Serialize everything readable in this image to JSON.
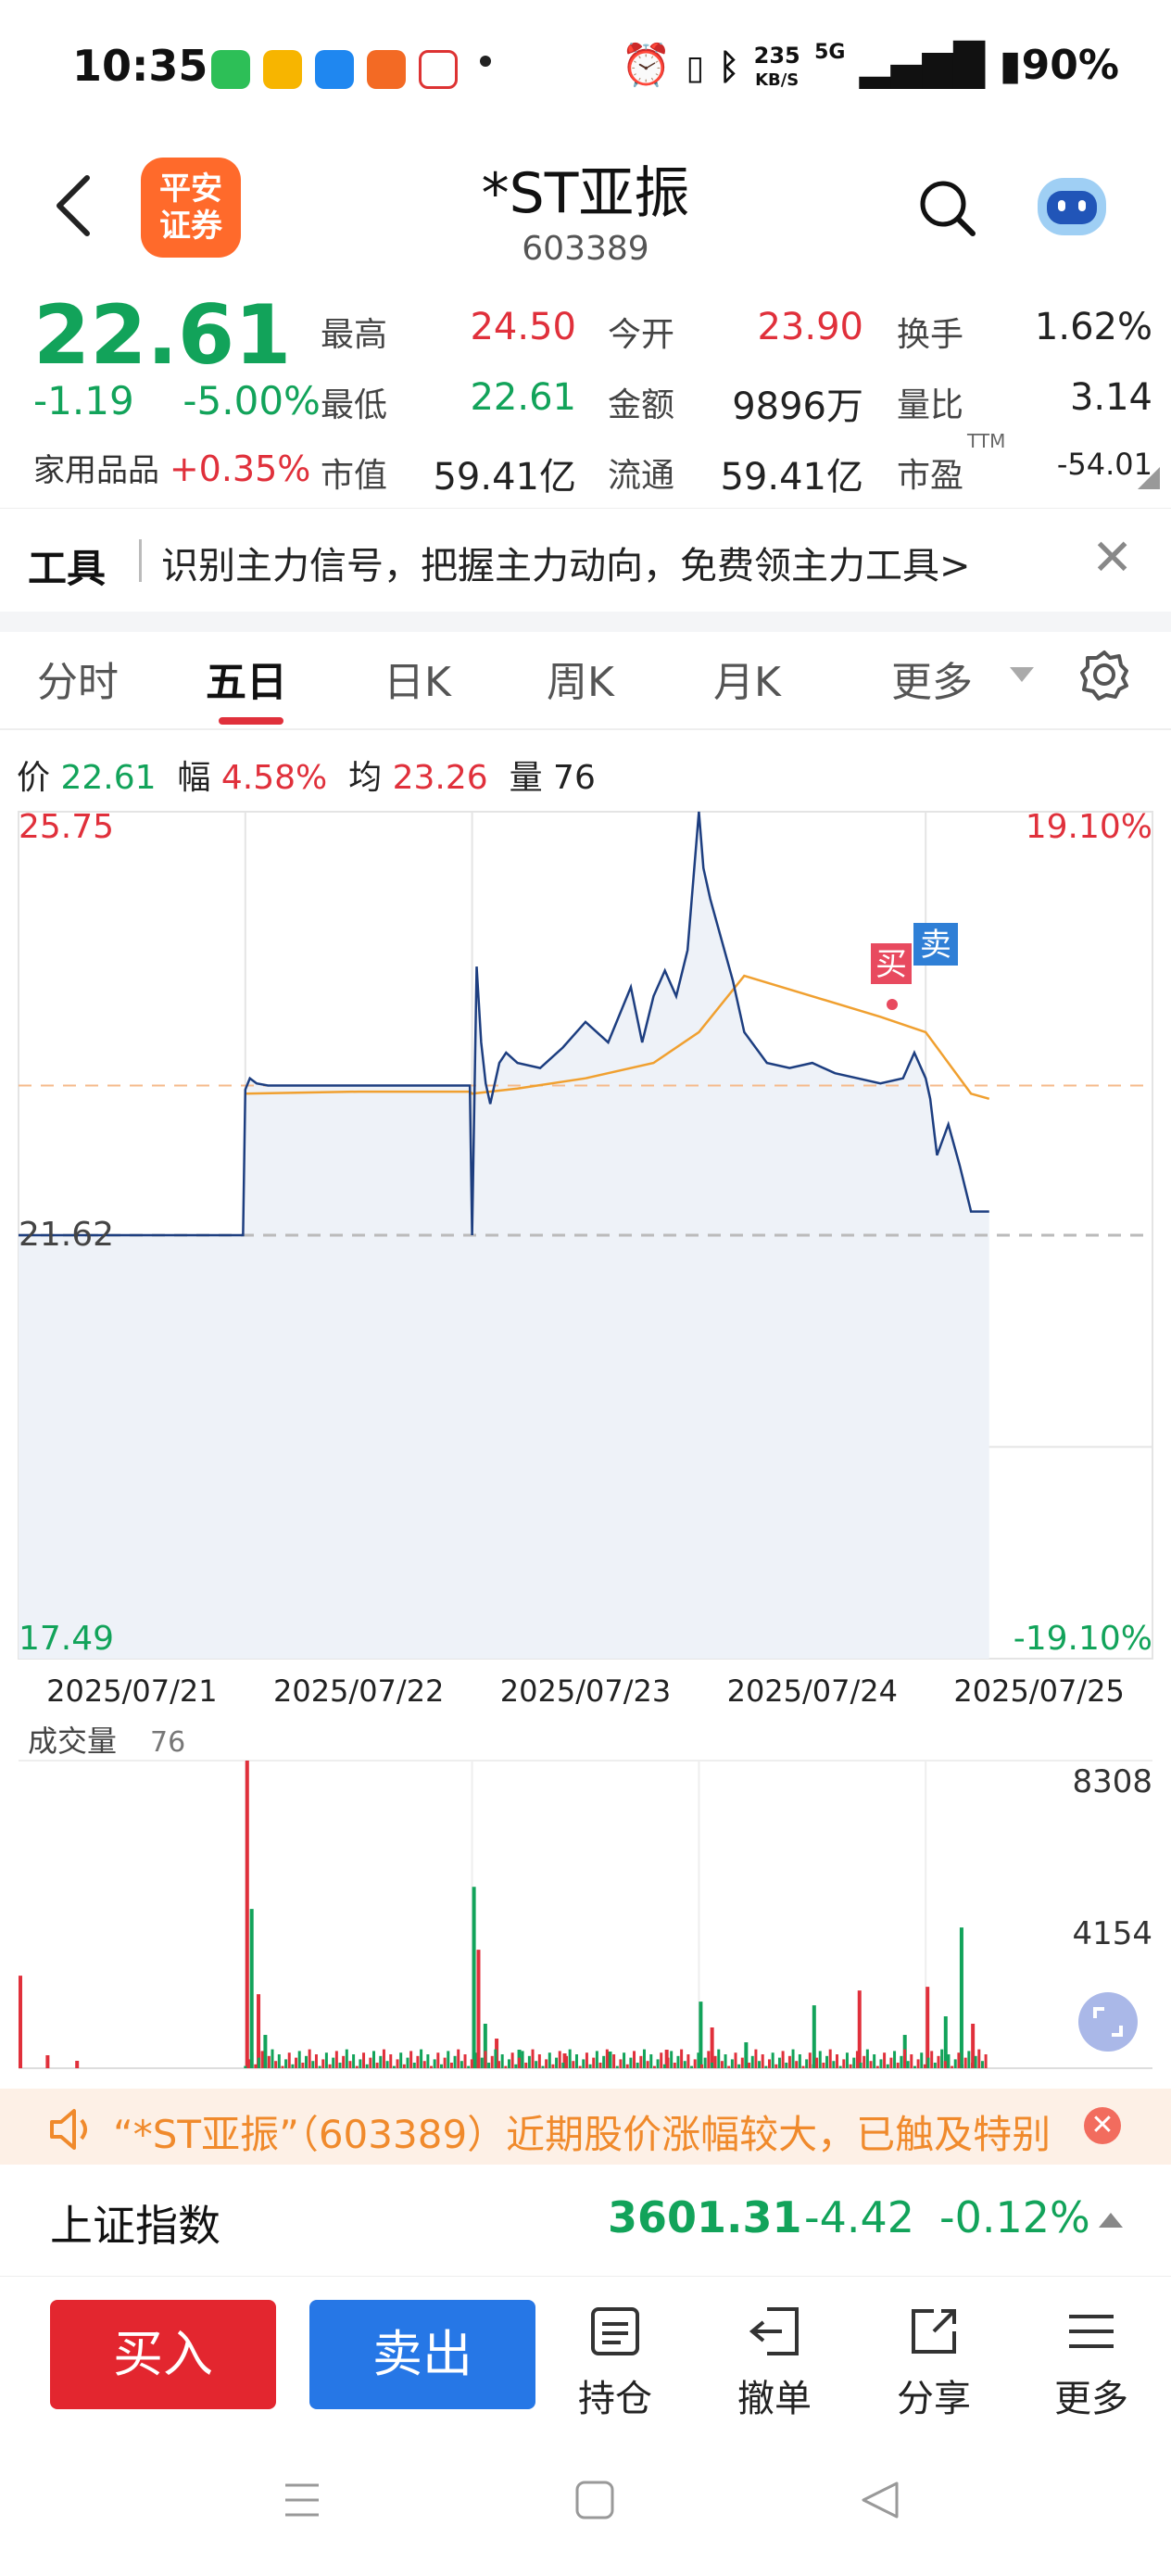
{
  "status": {
    "time": "10:35",
    "net_speed": "235",
    "net_unit": "KB/S",
    "signal": "5G",
    "battery": "90%"
  },
  "header": {
    "name": "*ST亚振",
    "code": "603389",
    "logo": "平安\n证券"
  },
  "quote": {
    "price": "22.61",
    "change": "-1.19",
    "change_pct": "-5.00%",
    "sector": "家用品品",
    "sector_pct": "+0.35%",
    "fields": [
      {
        "label": "最高",
        "value": "24.50",
        "color": "#e0303b"
      },
      {
        "label": "今开",
        "value": "23.90",
        "color": "#e0303b"
      },
      {
        "label": "换手",
        "value": "1.62%",
        "color": "#222"
      },
      {
        "label": "最低",
        "value": "22.61",
        "color": "#12a35a"
      },
      {
        "label": "金额",
        "value": "9896万",
        "color": "#222"
      },
      {
        "label": "量比",
        "value": "3.14",
        "color": "#222"
      },
      {
        "label": "市值",
        "value": "59.41亿",
        "color": "#222"
      },
      {
        "label": "流通",
        "value": "59.41亿",
        "color": "#222"
      },
      {
        "label": "市盈",
        "value": "-54.01",
        "color": "#222"
      }
    ],
    "pe_sup": "TTM"
  },
  "promo": {
    "tag": "工具",
    "text": "识别主力信号，把握主力动向，免费领主力工具>"
  },
  "tabs": [
    "分时",
    "五日",
    "日K",
    "周K",
    "月K",
    "更多"
  ],
  "active_tab": 1,
  "info": {
    "price_label": "价",
    "price": "22.61",
    "amp_label": "幅",
    "amp": "4.58%",
    "avg_label": "均",
    "avg": "23.26",
    "vol_label": "量",
    "vol": "76"
  },
  "chart_labels": {
    "top_price": "25.75",
    "top_pct": "19.10%",
    "mid_price": "21.62",
    "bottom_price": "17.49",
    "bottom_pct": "-19.10%",
    "buy": "买",
    "sell": "卖",
    "vol_title": "成交量",
    "vol_value": "76",
    "vol_max": "8308",
    "vol_mid": "4154"
  },
  "chart_data": {
    "type": "line",
    "title": "",
    "dates": [
      "2025/07/21",
      "2025/07/22",
      "2025/07/23",
      "2025/07/24",
      "2025/07/25"
    ],
    "ylim": [
      17.49,
      25.75
    ],
    "pct_range": [
      "-19.10%",
      "19.10%"
    ],
    "prev_close": 21.62,
    "series": [
      {
        "name": "",
        "x": [
          0,
          0.5,
          0.99,
          1.0,
          1.02,
          1.05,
          1.1,
          1.5,
          1.99,
          2.0,
          2.02,
          2.04,
          2.06,
          2.08,
          2.1,
          2.12,
          2.15,
          2.2,
          2.3,
          2.4,
          2.5,
          2.6,
          2.7,
          2.75,
          2.8,
          2.85,
          2.9,
          2.95,
          3.0,
          3.02,
          3.05,
          3.1,
          3.15,
          3.2,
          3.3,
          3.4,
          3.5,
          3.6,
          3.7,
          3.8,
          3.9,
          3.95,
          4.0,
          4.02,
          4.05,
          4.1,
          4.15,
          4.2,
          4.28
        ],
        "y": [
          21.62,
          21.62,
          21.62,
          23.04,
          23.15,
          23.1,
          23.08,
          23.08,
          23.08,
          21.62,
          24.24,
          23.5,
          23.1,
          22.9,
          23.1,
          23.3,
          23.4,
          23.3,
          23.25,
          23.45,
          23.7,
          23.5,
          24.04,
          23.5,
          23.95,
          24.2,
          23.95,
          24.4,
          25.75,
          25.2,
          24.9,
          24.5,
          24.1,
          23.6,
          23.3,
          23.25,
          23.3,
          23.2,
          23.15,
          23.1,
          23.15,
          23.4,
          23.15,
          22.95,
          22.4,
          22.7,
          22.3,
          21.85,
          21.85
        ]
      },
      {
        "name": "",
        "x": [
          1.0,
          1.5,
          1.99,
          2.0,
          2.2,
          2.5,
          2.8,
          3.0,
          3.2,
          3.5,
          3.8,
          4.0,
          4.1,
          4.2,
          4.28
        ],
        "y": [
          23.0,
          23.02,
          23.02,
          23.0,
          23.05,
          23.15,
          23.3,
          23.6,
          24.15,
          23.95,
          23.75,
          23.6,
          23.3,
          23.0,
          22.95
        ]
      }
    ],
    "volume": {
      "ylim": [
        0,
        8308
      ],
      "spikes": [
        {
          "x": 0.0,
          "v": 2500,
          "c": "r"
        },
        {
          "x": 0.12,
          "v": 350,
          "c": "r"
        },
        {
          "x": 0.25,
          "v": 200,
          "c": "r"
        },
        {
          "x": 1.0,
          "v": 8308,
          "c": "r"
        },
        {
          "x": 1.02,
          "v": 4300,
          "c": "g"
        },
        {
          "x": 1.05,
          "v": 2000,
          "c": "r"
        },
        {
          "x": 1.08,
          "v": 900,
          "c": "g"
        },
        {
          "x": 2.0,
          "v": 4900,
          "c": "g"
        },
        {
          "x": 2.02,
          "v": 3200,
          "c": "r"
        },
        {
          "x": 2.05,
          "v": 1200,
          "c": "g"
        },
        {
          "x": 2.1,
          "v": 800,
          "c": "r"
        },
        {
          "x": 2.2,
          "v": 500,
          "c": "g"
        },
        {
          "x": 2.4,
          "v": 400,
          "c": "r"
        },
        {
          "x": 2.6,
          "v": 450,
          "c": "g"
        },
        {
          "x": 2.85,
          "v": 500,
          "c": "r"
        },
        {
          "x": 3.0,
          "v": 1800,
          "c": "g"
        },
        {
          "x": 3.05,
          "v": 1100,
          "c": "r"
        },
        {
          "x": 3.2,
          "v": 700,
          "c": "g"
        },
        {
          "x": 3.5,
          "v": 1700,
          "c": "g"
        },
        {
          "x": 3.7,
          "v": 2100,
          "c": "r"
        },
        {
          "x": 3.9,
          "v": 900,
          "c": "g"
        },
        {
          "x": 4.0,
          "v": 2200,
          "c": "r"
        },
        {
          "x": 4.08,
          "v": 1400,
          "c": "g"
        },
        {
          "x": 4.15,
          "v": 3800,
          "c": "g"
        },
        {
          "x": 4.2,
          "v": 1200,
          "c": "r"
        }
      ]
    }
  },
  "warning": {
    "text": "“*ST亚振”（603389）近期股价涨幅较大，已触及特别"
  },
  "index": {
    "name": "上证指数",
    "value": "3601.31",
    "change": "-4.42",
    "pct": "-0.12%"
  },
  "toolbar": {
    "buy": "买入",
    "sell": "卖出",
    "tools": [
      "持仓",
      "撤单",
      "分享",
      "更多"
    ]
  }
}
